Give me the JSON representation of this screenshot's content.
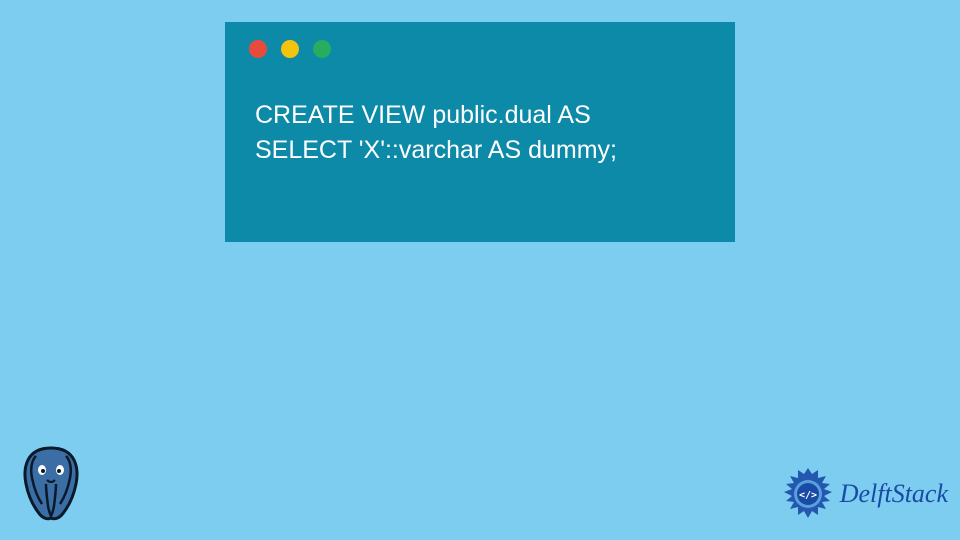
{
  "code": {
    "line1": "CREATE VIEW public.dual AS",
    "line2": "SELECT 'X'::varchar AS dummy;"
  },
  "window": {
    "dots": [
      "close",
      "minimize",
      "maximize"
    ]
  },
  "branding": {
    "delftstack_label": "DelftStack",
    "delft_code_symbol": "</>"
  },
  "icons": {
    "postgres": "postgres-elephant",
    "delft_badge": "delftstack-badge"
  },
  "colors": {
    "bg": "#7dcdf0",
    "window": "#0d8aa8",
    "accent": "#1a4aa8"
  }
}
